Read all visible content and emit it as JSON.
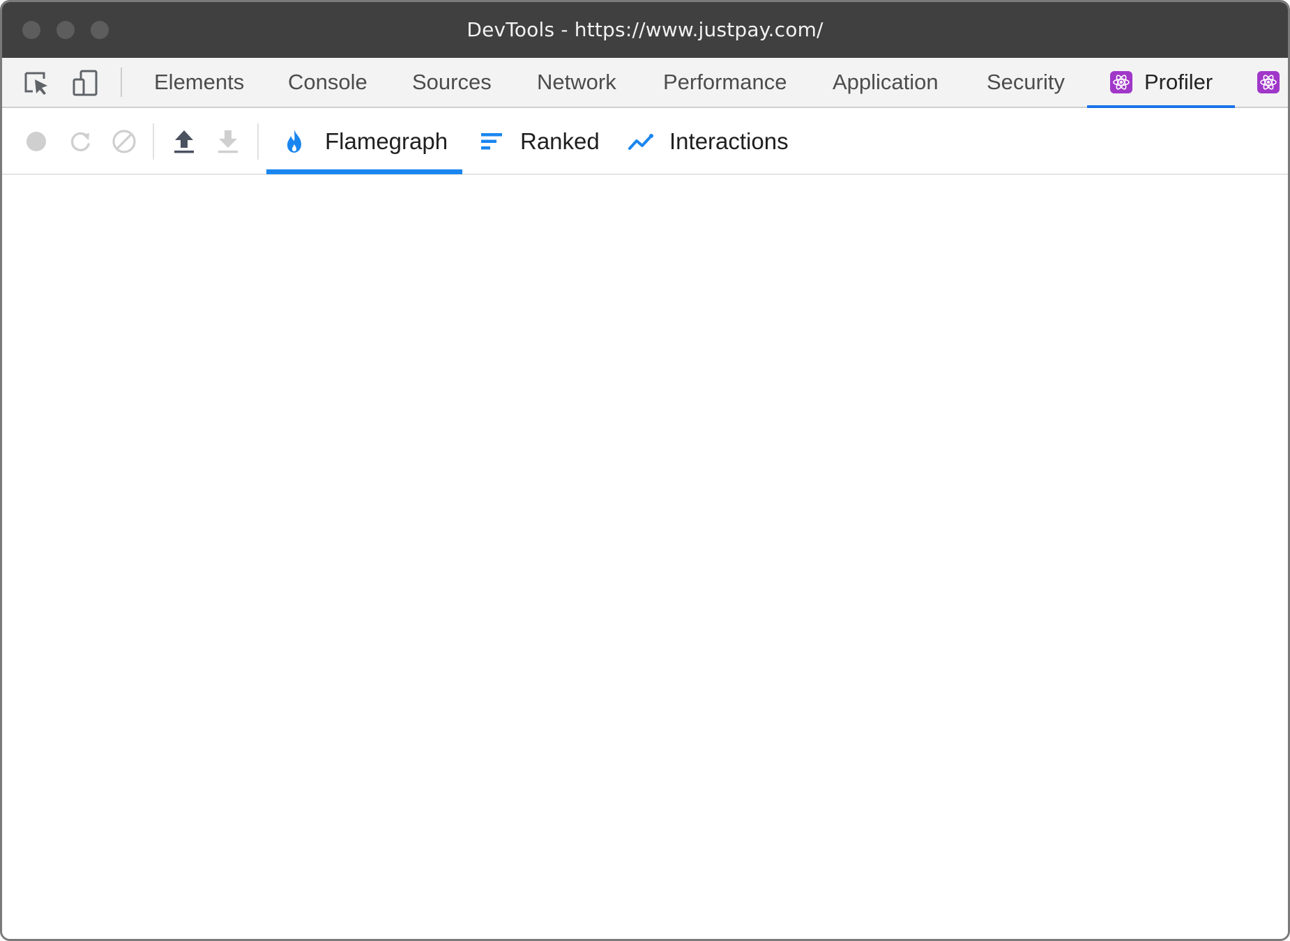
{
  "window": {
    "title": "DevTools - https://www.justpay.com/"
  },
  "devtools": {
    "tabs": [
      {
        "label": "Elements"
      },
      {
        "label": "Console"
      },
      {
        "label": "Sources"
      },
      {
        "label": "Network"
      },
      {
        "label": "Performance"
      },
      {
        "label": "Application"
      },
      {
        "label": "Security"
      },
      {
        "label": "Profiler",
        "active": true,
        "icon": "react-icon"
      }
    ],
    "overflow_tab_icon": "react-icon",
    "accent_color": "#1a73e8",
    "react_badge_color": "#a037c9"
  },
  "profiler": {
    "toolbar_buttons": [
      {
        "name": "record-button",
        "icon": "record-icon",
        "enabled": false
      },
      {
        "name": "reload-and-profile-button",
        "icon": "reload-icon",
        "enabled": false
      },
      {
        "name": "clear-button",
        "icon": "clear-icon",
        "enabled": false
      },
      {
        "name": "load-profile-button",
        "icon": "upload-icon",
        "enabled": true
      },
      {
        "name": "save-profile-button",
        "icon": "download-icon",
        "enabled": false
      }
    ],
    "view_tabs": [
      {
        "label": "Flamegraph",
        "icon": "flame-icon",
        "active": true
      },
      {
        "label": "Ranked",
        "icon": "ranked-bars-icon",
        "active": false
      },
      {
        "label": "Interactions",
        "icon": "line-chart-icon",
        "active": false
      }
    ],
    "accent_color": "#1a86f0"
  }
}
